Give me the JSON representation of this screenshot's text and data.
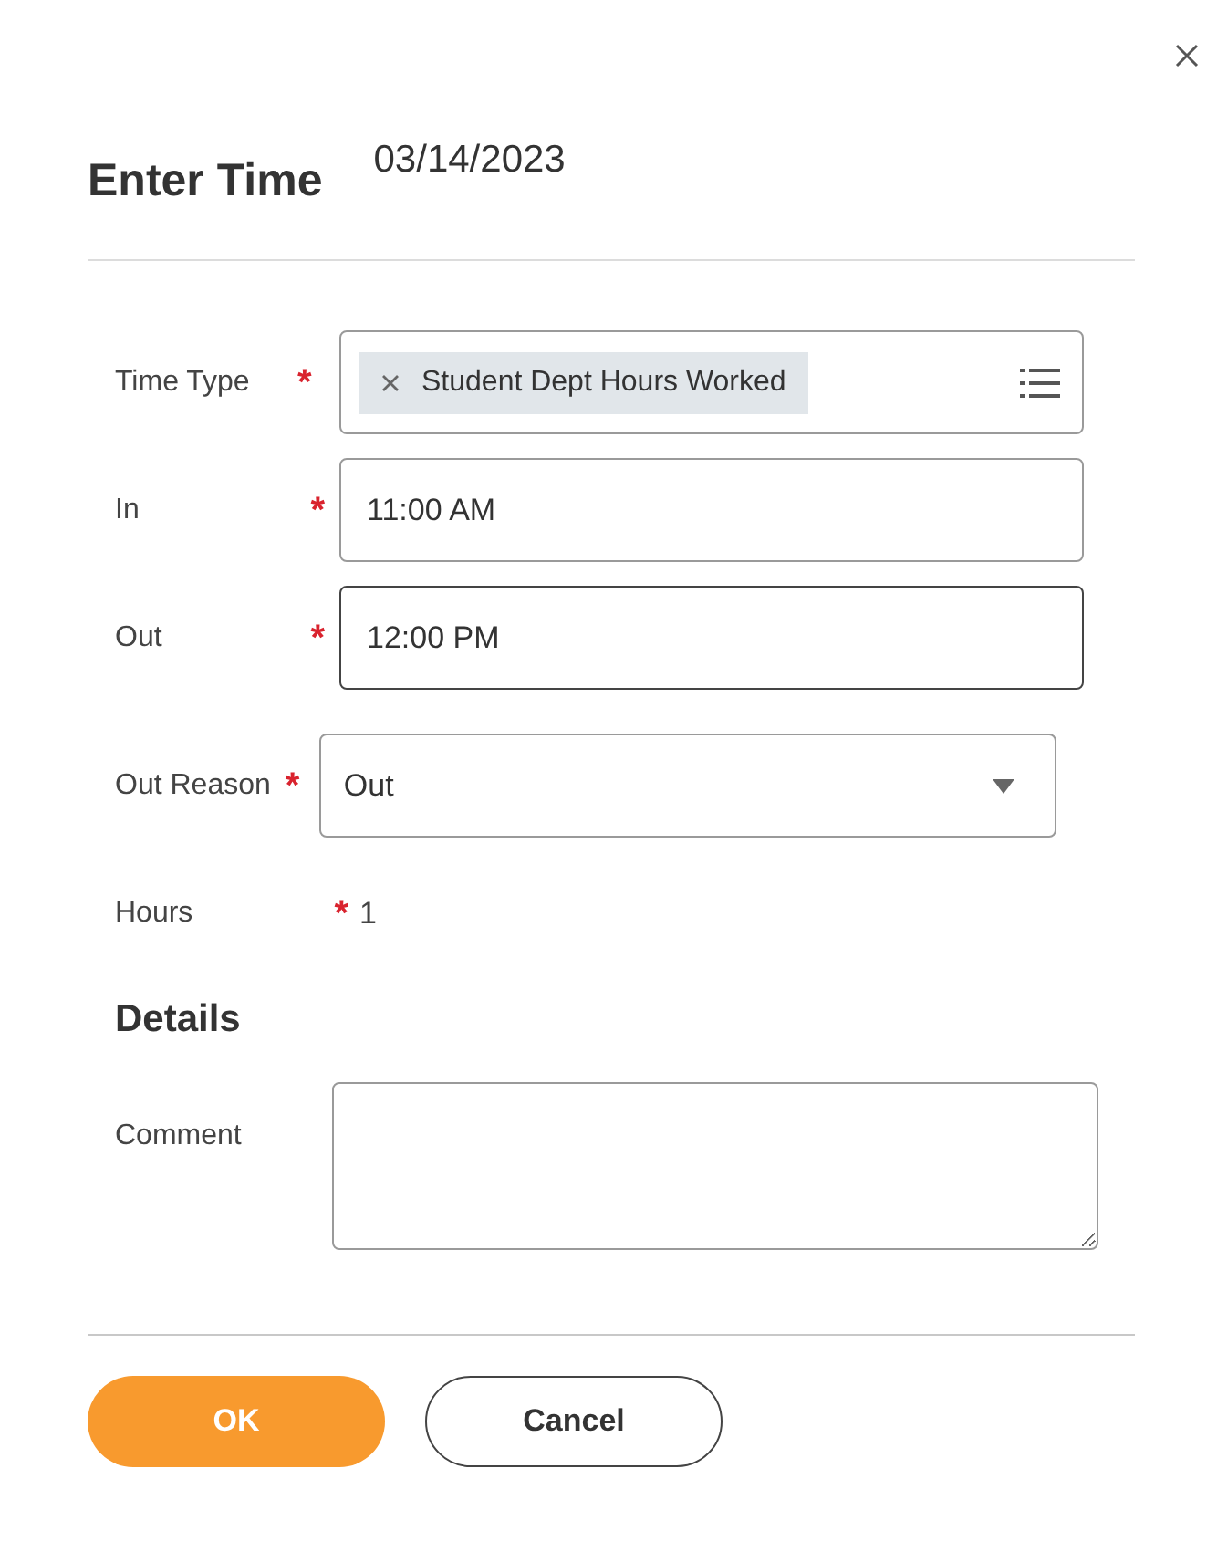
{
  "dialog": {
    "title": "Enter Time",
    "date": "03/14/2023"
  },
  "fields": [
    {
      "kind": "chips",
      "label": "Time Type",
      "required": "*",
      "chips": [
        "Student Dept Hours Worked"
      ],
      "focused": false
    },
    {
      "kind": "text",
      "label": "In",
      "required": "*",
      "value": "11:00 AM",
      "focused": false
    },
    {
      "kind": "text",
      "label": "Out",
      "required": "*",
      "value": "12:00 PM",
      "focused": true
    },
    {
      "kind": "select",
      "label": "Out Reason",
      "required": "*",
      "value": "Out",
      "focused": false
    },
    {
      "kind": "value",
      "label": "Hours",
      "required": "*",
      "value": "1",
      "focused": false
    }
  ],
  "details": {
    "heading": "Details",
    "comment": {
      "label": "Comment"
    }
  },
  "buttons": [
    {
      "kind": "primary",
      "label": "OK"
    },
    {
      "kind": "secondary",
      "label": "Cancel"
    }
  ]
}
